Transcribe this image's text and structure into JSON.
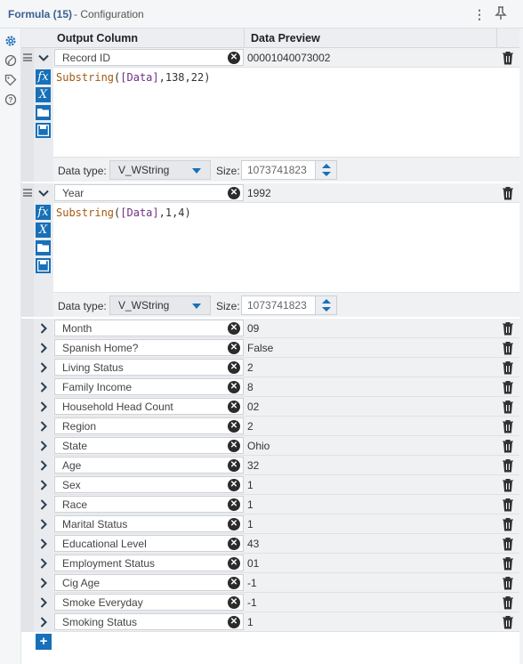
{
  "window": {
    "title": "Formula (15)",
    "subtitle": "- Configuration"
  },
  "grid": {
    "col_output": "Output Column",
    "col_preview": "Data Preview"
  },
  "expanded": [
    {
      "name": "Record ID",
      "preview": "00001040073002",
      "expr": {
        "fn": "Substring",
        "open": "(",
        "field": "[Data]",
        "args": ",138,22)"
      },
      "datatype_label": "Data type:",
      "datatype": "V_WString",
      "size_label": "Size:",
      "size": "1073741823"
    },
    {
      "name": "Year",
      "preview": "1992",
      "expr": {
        "fn": "Substring",
        "open": "(",
        "field": "[Data]",
        "args": ",1,4)"
      },
      "datatype_label": "Data type:",
      "datatype": "V_WString",
      "size_label": "Size:",
      "size": "1073741823"
    }
  ],
  "rows": [
    {
      "name": "Month",
      "preview": "09"
    },
    {
      "name": "Spanish Home?",
      "preview": "False"
    },
    {
      "name": "Living Status",
      "preview": "2"
    },
    {
      "name": "Family Income",
      "preview": "8"
    },
    {
      "name": "Household Head Count",
      "preview": "02"
    },
    {
      "name": "Region",
      "preview": "2"
    },
    {
      "name": "State",
      "preview": "Ohio"
    },
    {
      "name": "Age",
      "preview": "32"
    },
    {
      "name": "Sex",
      "preview": "1"
    },
    {
      "name": "Race",
      "preview": "1"
    },
    {
      "name": "Marital Status",
      "preview": "1"
    },
    {
      "name": "Educational Level",
      "preview": "43"
    },
    {
      "name": "Employment Status",
      "preview": "01"
    },
    {
      "name": "Cig Age",
      "preview": "-1"
    },
    {
      "name": "Smoke Everyday",
      "preview": "-1"
    },
    {
      "name": "Smoking Status",
      "preview": "1"
    }
  ],
  "colors": {
    "accent": "#1770b8",
    "header_text": "#3a5f96"
  },
  "icons": [
    "settings-icon",
    "annotation-icon",
    "tag-icon",
    "help-icon",
    "more-icon",
    "pin-icon",
    "drag-handle-icon",
    "chevron-down-icon",
    "chevron-right-icon",
    "clear-icon",
    "trash-icon",
    "function-icon",
    "variable-icon",
    "open-folder-icon",
    "save-icon",
    "add-icon"
  ]
}
